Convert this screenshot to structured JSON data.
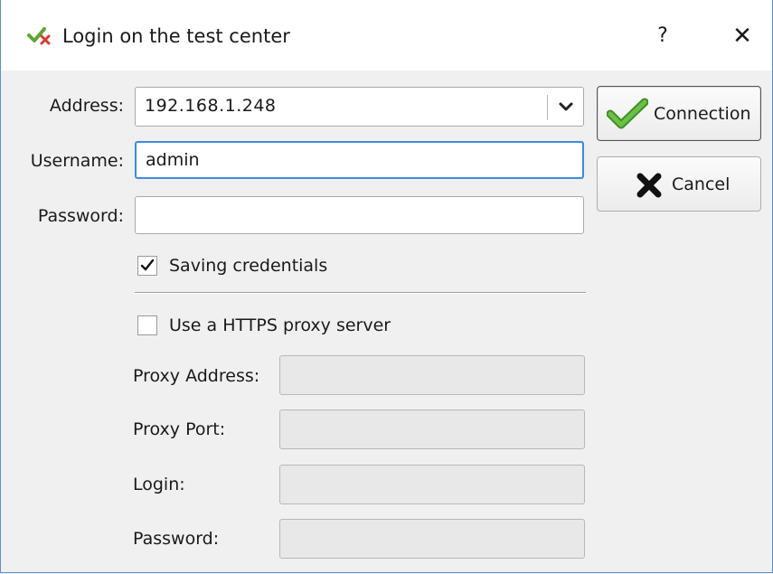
{
  "window": {
    "title": "Login on the test center",
    "help_label": "?",
    "close_label": "✕"
  },
  "form": {
    "address_label": "Address:",
    "address_value": "192.168.1.248",
    "username_label": "Username:",
    "username_value": "admin",
    "password_label": "Password:",
    "password_value": "",
    "save_credentials_label": "Saving credentials",
    "save_credentials_checked": true
  },
  "proxy": {
    "use_proxy_label": "Use a HTTPS proxy server",
    "use_proxy_checked": false,
    "address_label": "Proxy Address:",
    "address_value": "",
    "port_label": "Proxy Port:",
    "port_value": "",
    "login_label": "Login:",
    "login_value": "",
    "password_label": "Password:",
    "password_value": ""
  },
  "buttons": {
    "connection_label": "Connection",
    "cancel_label": "Cancel"
  },
  "icons": {
    "title": "checkmark-cross-app-icon",
    "connection": "green-checkmark-icon",
    "cancel": "black-cross-icon",
    "dropdown": "chevron-down-icon"
  },
  "colors": {
    "focus_border": "#3c8ce0",
    "check_green": "#5aa832",
    "window_border": "#5b8ed6"
  }
}
